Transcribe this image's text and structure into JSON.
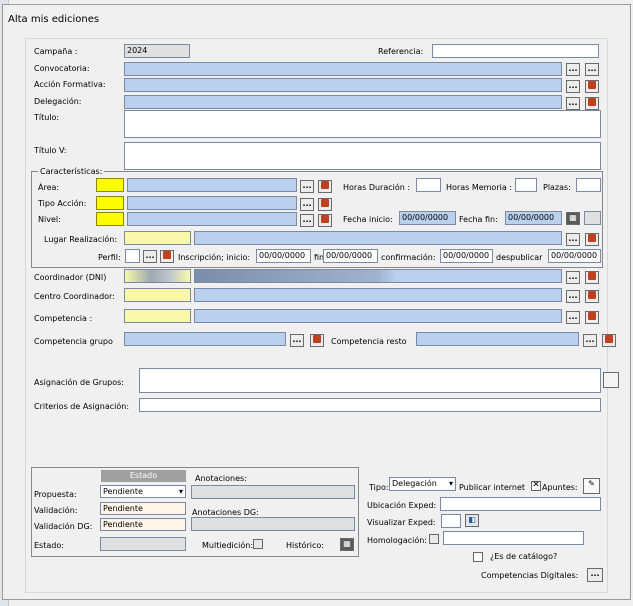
{
  "window": {
    "title": "Alta mis ediciones"
  },
  "top": {
    "campana_label": "Campaña :",
    "campana_value": "2024",
    "referencia_label": "Referencia:",
    "convocatoria_label": "Convocatoria:",
    "accion_label": "Acción Formativa:",
    "delegacion_label": "Delegación:",
    "titulo_label": "Título:",
    "titulov_label": "Título V:"
  },
  "car": {
    "legend": "Características:",
    "area_label": "Área:",
    "tipo_label": "Tipo Acción:",
    "nivel_label": "Nivel:",
    "lugar_label": "Lugar Realización:",
    "perfil_label": "Perfil:",
    "horas_dur_label": "Horas Duración :",
    "horas_mem_label": "Horas Memoria :",
    "plazas_label": "Plazas:",
    "fecha_ini_label": "Fecha inicio:",
    "fecha_ini": "00/00/0000",
    "fecha_fin_label": "Fecha fin:",
    "fecha_fin": "00/00/0000",
    "inscripcion_label": "Inscripción; inicio:",
    "insc_ini": "00/00/0000",
    "fin_label": "fin:",
    "insc_fin": "00/00/0000",
    "conf_label": "confirmación:",
    "conf": "00/00/0000",
    "despub_label": "despublicar",
    "despub": "00/00/0000"
  },
  "coord": {
    "coordinador_label": "Coordinador (DNI)",
    "centro_label": "Centro Coordinador:",
    "competencia_label": "Competencia :",
    "comp_grupo_label": "Competencia grupo",
    "comp_resto_label": "Competencia resto",
    "asig_grupos_label": "Asignación de Grupos:",
    "criterios_label": "Criterios de Asignación:"
  },
  "estado": {
    "header": "Estado",
    "propuesta_label": "Propuesta:",
    "propuesta_value": "Pendiente",
    "validacion_label": "Validación:",
    "validacion_value": "Pendiente",
    "validacion_dg_label": "Validación DG:",
    "validacion_dg_value": "Pendiente",
    "estado_label": "Estado:",
    "anotaciones_label": "Anotaciones:",
    "anotaciones_dg_label": "Anotaciones DG:",
    "multiedicion_label": "Multiedición:",
    "historico_label": "Histórico:"
  },
  "right": {
    "tipo_label": "Tipo:",
    "tipo_value": "Delegación",
    "publicar_label": "Publicar internet",
    "apuntes_label": "Apuntes:",
    "ubicacion_label": "Ubicación Exped:",
    "visualizar_label": "Visualizar Exped:",
    "homologacion_label": "Homologación:",
    "catalogo_label": "¿Es de catálogo?",
    "comp_digitales_label": "Competencias Digitales:"
  },
  "icons": {
    "dots": "...",
    "browse": "browse-icon",
    "calendar": "calendar-icon"
  },
  "colors": {
    "field_blue": "#b9d1ec",
    "field_yellow": "#fcfc00",
    "field_light_yellow": "#f8f8a8",
    "header_gray": "#a0a0a0"
  }
}
